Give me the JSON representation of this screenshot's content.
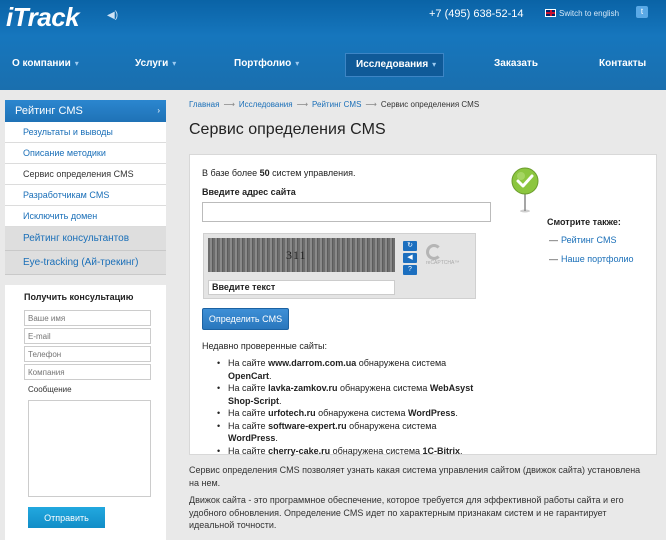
{
  "header": {
    "logo": "iTrack",
    "phone": "+7 (495) 638-52-14",
    "switch_lang": "Switch to english"
  },
  "nav": [
    {
      "label": "О компании",
      "chevron": true
    },
    {
      "label": "Услуги",
      "chevron": true
    },
    {
      "label": "Портфолио",
      "chevron": true
    },
    {
      "label": "Исследования",
      "chevron": true,
      "active": true
    },
    {
      "label": "Заказать",
      "chevron": false
    },
    {
      "label": "Контакты",
      "chevron": false
    }
  ],
  "sidebar": {
    "head": "Рейтинг CMS",
    "items": [
      "Результаты и выводы",
      "Описание методики",
      "Сервис определения CMS",
      "Разработчикам CMS",
      "Исключить домен"
    ],
    "current_index": 2,
    "sections": [
      "Рейтинг консультантов",
      "Eye-tracking (Ай-трекинг)"
    ]
  },
  "consult": {
    "title": "Получить консультацию",
    "name_placeholder": "Ваше имя",
    "email_placeholder": "E-mail",
    "phone_placeholder": "Телефон",
    "company_placeholder": "Компания",
    "message_label": "Сообщение",
    "send_label": "Отправить"
  },
  "breadcrumb": {
    "items": [
      "Главная",
      "Исследования",
      "Рейтинг CMS"
    ],
    "separator": "⟶",
    "current": "Сервис определения CMS"
  },
  "page_title": "Сервис определения CMS",
  "panel": {
    "base_prefix": "В базе более ",
    "base_count": "50",
    "base_suffix": " систем управления.",
    "url_label": "Введите адрес сайта",
    "captcha_word": "311",
    "captcha_input_label": "Введите текст",
    "recaptcha_label": "reCAPTCHA™",
    "detect_label": "Определить CMS",
    "recent_title": "Недавно проверенные сайты:",
    "recent": [
      {
        "pre": "На сайте ",
        "site": "www.darrom.com.ua",
        "mid": " обнаружена система ",
        "cms": "OpenCart",
        "end": "."
      },
      {
        "pre": "На сайте ",
        "site": "lavka-zamkov.ru",
        "mid": " обнаружена система ",
        "cms": "WebAsyst Shop-Script",
        "end": "."
      },
      {
        "pre": "На сайте ",
        "site": "urfotech.ru",
        "mid": " обнаружена система ",
        "cms": "WordPress",
        "end": "."
      },
      {
        "pre": "На сайте ",
        "site": "software-expert.ru",
        "mid": " обнаружена система ",
        "cms": "WordPress",
        "end": "."
      },
      {
        "pre": "На сайте ",
        "site": "cherry-cake.ru",
        "mid": " обнаружена система ",
        "cms": "1C-Bitrix",
        "end": "."
      }
    ],
    "see_also_title": "Смотрите также:",
    "see_also": [
      "Рейтинг CMS",
      "Наше портфолио"
    ]
  },
  "description": [
    "Сервис определения CMS позволяет узнать какая система управления сайтом (движок сайта) установлена на нем.",
    "Движок сайта - это программное обеспечение, которое требуется для эффективной работы сайта и его удобного обновления. Определение CMS идет по характерным признакам систем и не гарантирует идеальной точности."
  ],
  "colors": {
    "brand": "#1676bd",
    "link": "#1a6fb8",
    "pin": "#8cc63f"
  }
}
